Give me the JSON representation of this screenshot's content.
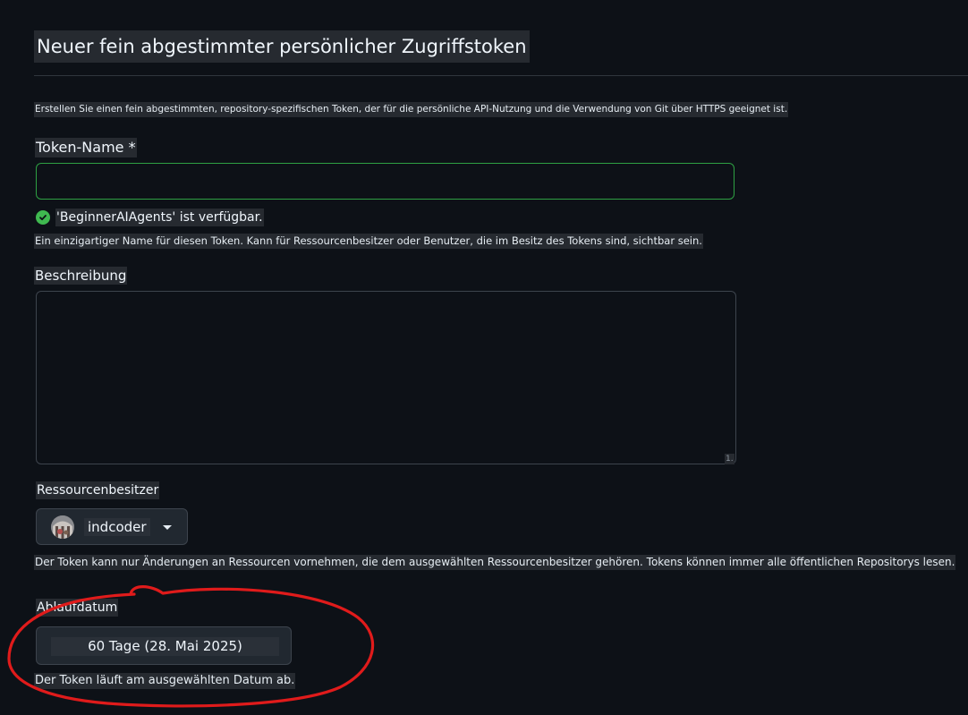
{
  "page": {
    "title": "Neuer fein abgestimmter persönlicher Zugriffstoken",
    "intro": "Erstellen Sie einen fein abgestimmten, repository-spezifischen Token, der für die persönliche API-Nutzung und die Verwendung von Git über HTTPS geeignet ist."
  },
  "token_name": {
    "label": "Token-Name *",
    "value": "",
    "availability": "'BeginnerAIAgents' ist verfügbar.",
    "help": "Ein einzigartiger Name für diesen Token. Kann für Ressourcenbesitzer oder Benutzer, die im Besitz des Tokens sind, sichtbar sein."
  },
  "description": {
    "label": "Beschreibung",
    "value": "",
    "grip": "1."
  },
  "resource_owner": {
    "label": "Ressourcenbesitzer",
    "selected": "indcoder",
    "help": "Der Token kann nur Änderungen an Ressourcen vornehmen, die dem ausgewählten Ressourcenbesitzer gehören. Tokens können immer alle öffentlichen Repositorys lesen."
  },
  "expiration": {
    "label": "Ablaufdatum",
    "selected": "60 Tage (28. Mai 2025)",
    "help": "Der Token läuft am ausgewählten Datum ab."
  },
  "colors": {
    "background": "#0d1117",
    "success": "#3fb950",
    "input_focus_border": "#2ea043",
    "annotation": "#e01b1b"
  },
  "icons": {
    "availability": "check-circle-icon",
    "dropdown": "caret-down-icon",
    "owner_avatar": "avatar"
  }
}
